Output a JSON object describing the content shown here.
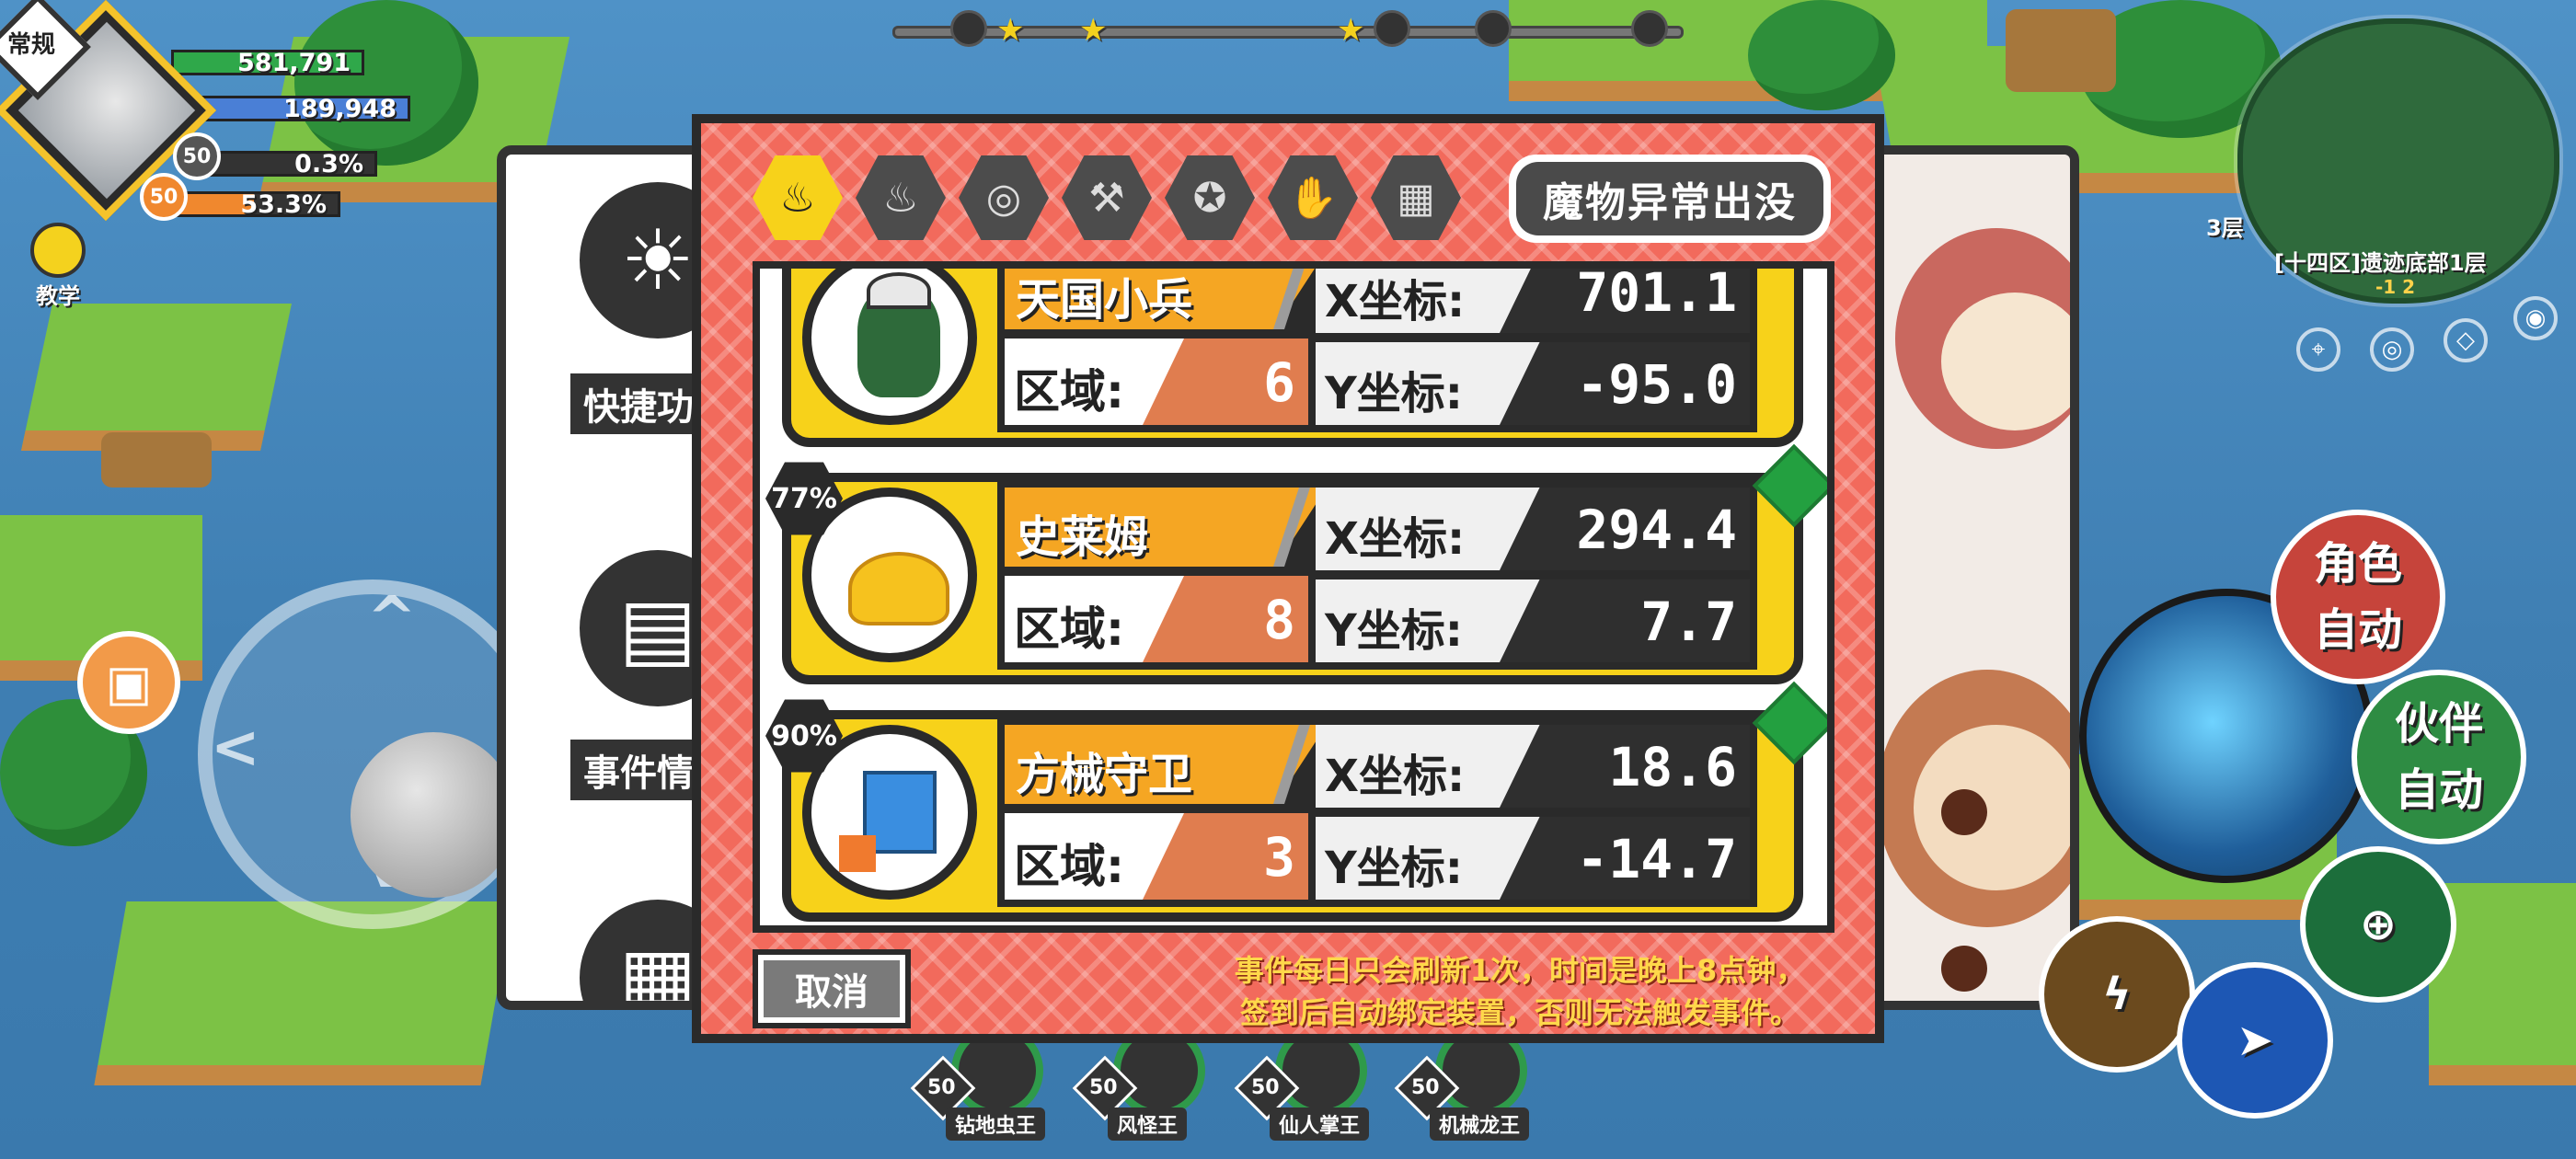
{
  "hud": {
    "mode_badge": "常规",
    "hp_value": "581,791",
    "mp_value": "189,948",
    "exp_percent": "0.3%",
    "other_percent": "53.3%",
    "level_top": "50",
    "level_bottom": "50",
    "tutorial_label": "教学",
    "colors": {
      "hp": "#2fa84a",
      "mp": "#4a7fd6",
      "exp": "#5fbde6",
      "other": "#f0882e"
    }
  },
  "minimap": {
    "floor_tag": "3层",
    "zone_label": "[十四区]遗迹底部1层",
    "coord": "-1 2",
    "icons": [
      "pin-icon",
      "target-icon",
      "mask-icon",
      "eye-icon"
    ]
  },
  "left_panel": {
    "items": [
      {
        "label": "快捷功",
        "icon": "lightbulb-icon"
      },
      {
        "label": "事件情",
        "icon": "document-icon"
      },
      {
        "label": "",
        "icon": "save-icon"
      }
    ]
  },
  "right_actions": {
    "role_auto": [
      "角色",
      "自动"
    ],
    "partner_auto": [
      "伙伴",
      "自动"
    ]
  },
  "bosses": [
    {
      "level": "50",
      "name": "钻地虫王"
    },
    {
      "level": "50",
      "name": "风怪王"
    },
    {
      "level": "50",
      "name": "仙人掌王"
    },
    {
      "level": "50",
      "name": "机械龙王"
    }
  ],
  "dialog": {
    "title": "魔物异常出没",
    "tabs": [
      {
        "icon": "flame-icon",
        "active": true
      },
      {
        "icon": "double-flame-icon",
        "active": false
      },
      {
        "icon": "coins-icon",
        "active": false
      },
      {
        "icon": "hammer-icon",
        "active": false
      },
      {
        "icon": "star-badge-icon",
        "active": false
      },
      {
        "icon": "hand-icon",
        "active": false
      },
      {
        "icon": "grid-icon",
        "active": false
      }
    ],
    "region_label": "区域:",
    "x_label": "X坐标:",
    "y_label": "Y坐标:",
    "entries": [
      {
        "name": "天国小兵",
        "region": "6",
        "x": "701.1",
        "y": "-95.0",
        "percent": ""
      },
      {
        "name": "史莱姆",
        "region": "8",
        "x": "294.4",
        "y": "7.7",
        "percent": "77%"
      },
      {
        "name": "方械守卫",
        "region": "3",
        "x": "18.6",
        "y": "-14.7",
        "percent": "90%"
      }
    ],
    "cancel_label": "取消",
    "notice_line1": "事件每日只会刷新1次，时间是晚上8点钟，",
    "notice_line2": "签到后自动绑定装置，否则无法触发事件。"
  }
}
